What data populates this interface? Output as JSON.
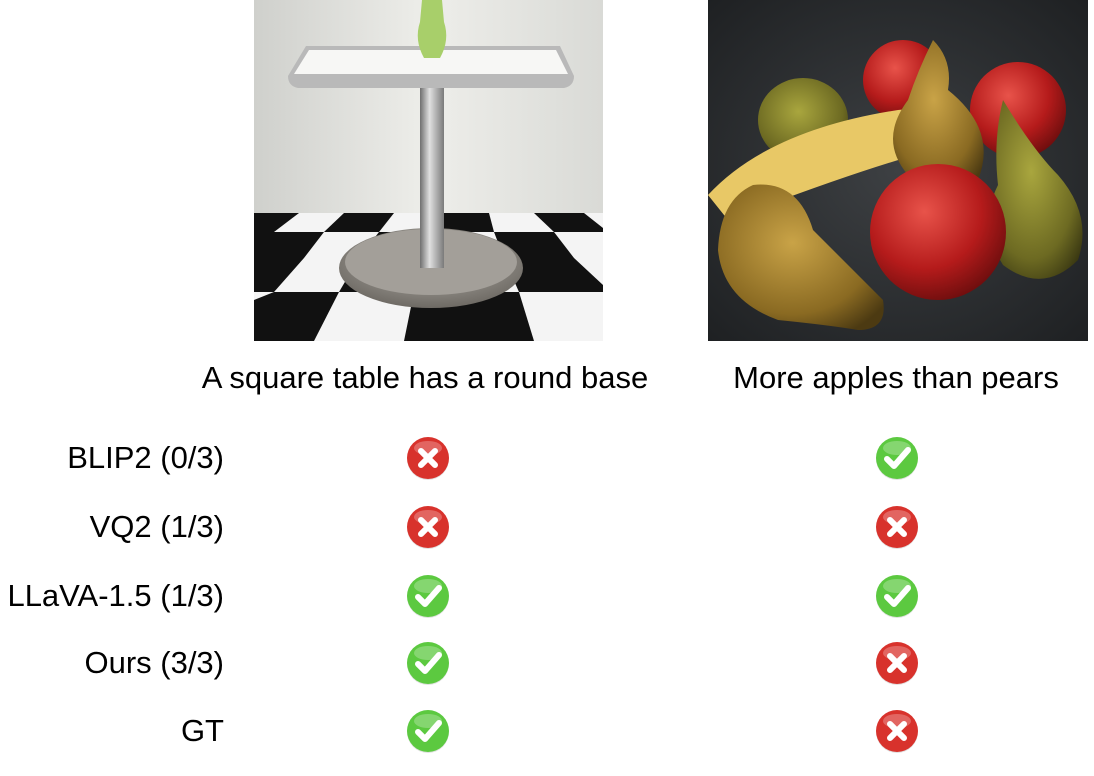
{
  "captions": [
    "A square table has a round base",
    "More apples than pears"
  ],
  "rows": [
    {
      "label": "BLIP2 (0/3)",
      "results": [
        "cross",
        "check"
      ]
    },
    {
      "label": "VQ2 (1/3)",
      "results": [
        "cross",
        "cross"
      ]
    },
    {
      "label": "LLaVA-1.5 (1/3)",
      "results": [
        "check",
        "check"
      ]
    },
    {
      "label": "Ours (3/3)",
      "results": [
        "check",
        "cross"
      ]
    },
    {
      "label": "GT",
      "results": [
        "check",
        "cross"
      ]
    }
  ],
  "icons": {
    "check": "check-icon",
    "cross": "cross-icon"
  },
  "colors": {
    "check": "#5cc940",
    "cross": "#d8322c"
  }
}
